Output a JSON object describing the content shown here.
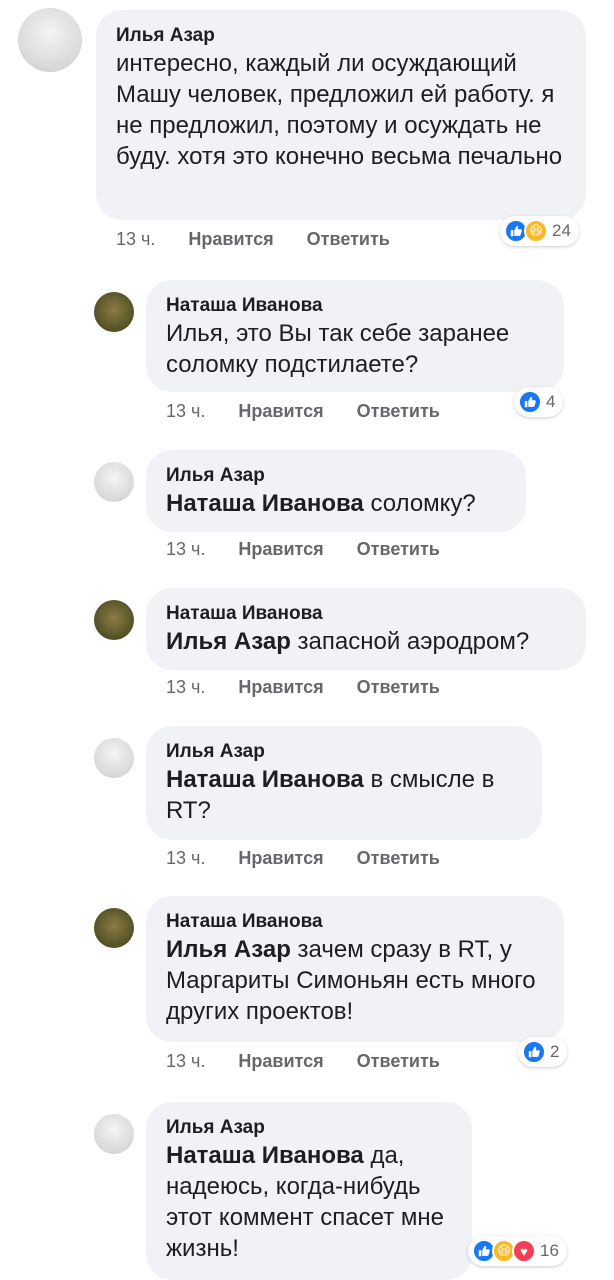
{
  "comments": [
    {
      "author": "Илья Азар",
      "mention": "",
      "text": "интересно, каждый ли осуждающий Машу человек, предложил ей работу. я не предложил, поэтому и осуждать не буду. хотя это конечно весьма печально",
      "time": "13 ч.",
      "like_label": "Нравится",
      "reply_label": "Ответить",
      "reactions": [
        "like",
        "haha"
      ],
      "reaction_count": "24"
    },
    {
      "author": "Наташа Иванова",
      "mention": "",
      "text": "Илья, это Вы так себе заранее соломку подстилаете?",
      "time": "13 ч.",
      "like_label": "Нравится",
      "reply_label": "Ответить",
      "reactions": [
        "like"
      ],
      "reaction_count": "4"
    },
    {
      "author": "Илья Азар",
      "mention": "Наташа Иванова",
      "text": " соломку?",
      "time": "13 ч.",
      "like_label": "Нравится",
      "reply_label": "Ответить",
      "reactions": [],
      "reaction_count": ""
    },
    {
      "author": "Наташа Иванова",
      "mention": "Илья Азар",
      "text": " запасной аэродром?",
      "time": "13 ч.",
      "like_label": "Нравится",
      "reply_label": "Ответить",
      "reactions": [],
      "reaction_count": ""
    },
    {
      "author": "Илья Азар",
      "mention": "Наташа Иванова",
      "text": " в смысле в RT?",
      "time": "13 ч.",
      "like_label": "Нравится",
      "reply_label": "Ответить",
      "reactions": [],
      "reaction_count": ""
    },
    {
      "author": "Наташа Иванова",
      "mention": "Илья Азар",
      "text": " зачем сразу в RT, у Маргариты Симоньян есть много других проектов!",
      "time": "13 ч.",
      "like_label": "Нравится",
      "reply_label": "Ответить",
      "reactions": [
        "like"
      ],
      "reaction_count": "2"
    },
    {
      "author": "Илья Азар",
      "mention": "Наташа Иванова",
      "text": " да, надеюсь, когда-нибудь этот коммент спасет мне жизнь!",
      "time": "",
      "like_label": "",
      "reply_label": "",
      "reactions": [
        "like",
        "haha",
        "love"
      ],
      "reaction_count": "16"
    }
  ],
  "colors": {
    "bubble": "#f0f2f5",
    "meta": "#65676b",
    "like": "#1877f2",
    "haha": "#f7b928",
    "love": "#f33e58"
  }
}
